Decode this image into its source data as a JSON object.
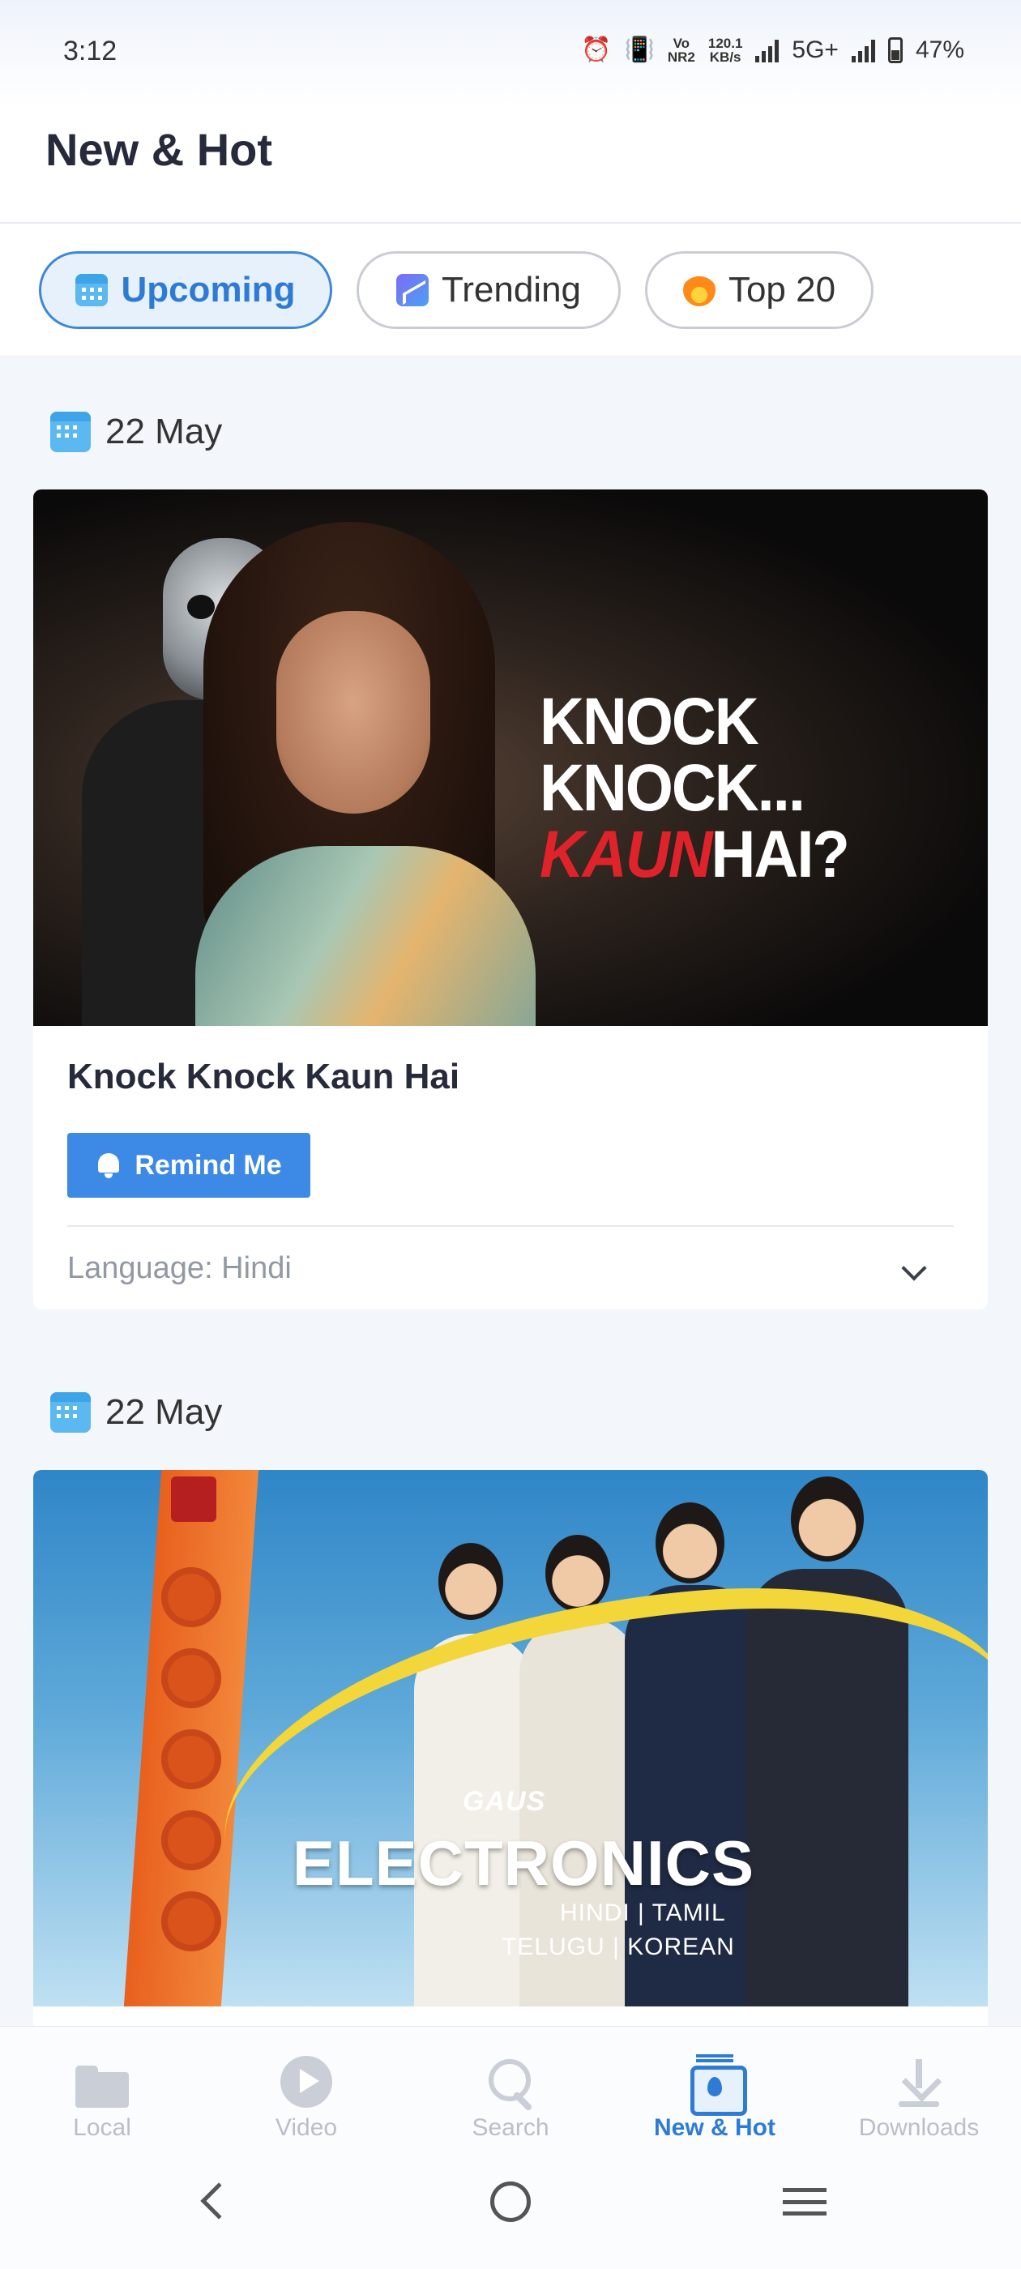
{
  "status_bar": {
    "time": "3:12",
    "vo_label": "Vo",
    "nr_label": "NR2",
    "speed_value": "120.1",
    "speed_unit": "KB/s",
    "network": "5G+",
    "battery": "47%"
  },
  "header": {
    "title": "New & Hot"
  },
  "tabs": [
    {
      "label": "Upcoming",
      "icon": "calendar-icon",
      "active": true
    },
    {
      "label": "Trending",
      "icon": "trending-icon",
      "active": false
    },
    {
      "label": "Top 20",
      "icon": "fire-icon",
      "active": false
    }
  ],
  "feed": [
    {
      "date": "22 May",
      "poster_title_line1": "KNOCK KNOCK...",
      "poster_title_red": "KAUN",
      "poster_title_line2": "HAI?",
      "title": "Knock Knock Kaun Hai",
      "remind_label": "Remind Me",
      "language": "Language: Hindi"
    },
    {
      "date": "22 May",
      "poster_small": "GAUS",
      "poster_title": "ELECTRONICS",
      "poster_langs_1": "HINDI | TAMIL",
      "poster_langs_2": "TELUGU | KOREAN"
    }
  ],
  "bottom_nav": [
    {
      "label": "Local",
      "icon": "folder-icon",
      "active": false
    },
    {
      "label": "Video",
      "icon": "play-icon",
      "active": false
    },
    {
      "label": "Search",
      "icon": "search-icon",
      "active": false
    },
    {
      "label": "New & Hot",
      "icon": "new-hot-icon",
      "active": true
    },
    {
      "label": "Downloads",
      "icon": "download-icon",
      "active": false
    }
  ],
  "colors": {
    "accent": "#2e7bd6",
    "button": "#3c89e6",
    "background": "#f3f6fb"
  }
}
